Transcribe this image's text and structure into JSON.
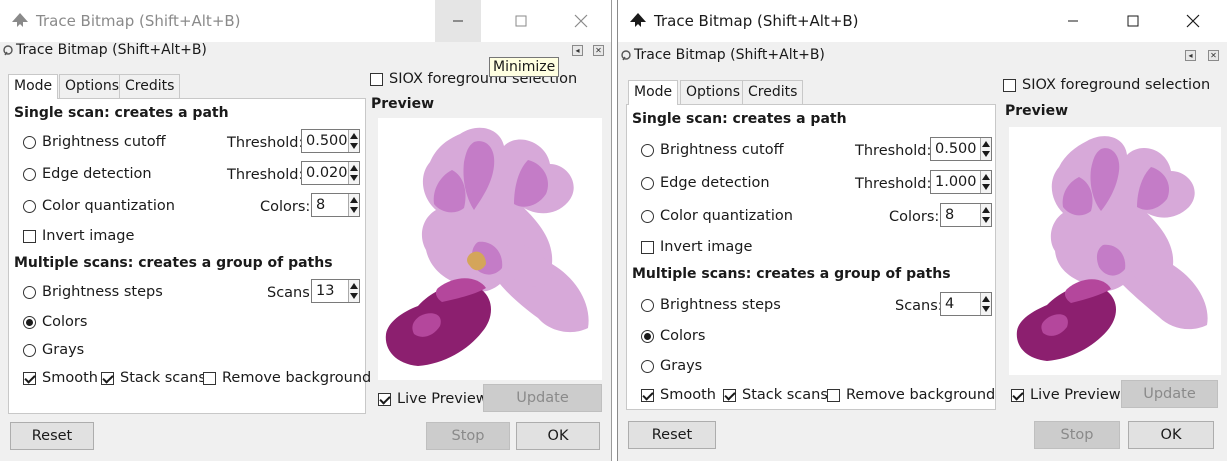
{
  "windows": [
    {
      "title": "Trace Bitmap (Shift+Alt+B)",
      "dock_title": "Trace Bitmap (Shift+Alt+B)",
      "tabs": [
        "Mode",
        "Options",
        "Credits"
      ],
      "siox_label": "SIOX foreground selection",
      "preview_label": "Preview",
      "single_heading": "Single scan: creates a path",
      "brightness_cutoff": "Brightness cutoff",
      "edge_detection": "Edge detection",
      "color_quantization": "Color quantization",
      "invert_image": "Invert image",
      "multiple_heading": "Multiple scans: creates a group of paths",
      "brightness_steps": "Brightness steps",
      "colors": "Colors",
      "grays": "Grays",
      "smooth": "Smooth",
      "stack_scans": "Stack scans",
      "remove_background": "Remove background",
      "threshold_label": "Threshold:",
      "threshold_brightness": "0.500",
      "threshold_edge": "0.020",
      "colors_label": "Colors:",
      "colors_value": "8",
      "scans_label": "Scans:",
      "scans_value": "13",
      "live_preview": "Live Preview",
      "update": "Update",
      "reset": "Reset",
      "stop": "Stop",
      "ok": "OK",
      "tooltip": "Minimize"
    },
    {
      "title": "Trace Bitmap (Shift+Alt+B)",
      "dock_title": "Trace Bitmap (Shift+Alt+B)",
      "tabs": [
        "Mode",
        "Options",
        "Credits"
      ],
      "siox_label": "SIOX foreground selection",
      "preview_label": "Preview",
      "single_heading": "Single scan: creates a path",
      "brightness_cutoff": "Brightness cutoff",
      "edge_detection": "Edge detection",
      "color_quantization": "Color quantization",
      "invert_image": "Invert image",
      "multiple_heading": "Multiple scans: creates a group of paths",
      "brightness_steps": "Brightness steps",
      "colors": "Colors",
      "grays": "Grays",
      "smooth": "Smooth",
      "stack_scans": "Stack scans",
      "remove_background": "Remove background",
      "threshold_label": "Threshold:",
      "threshold_brightness": "0.500",
      "threshold_edge": "1.000",
      "colors_label": "Colors:",
      "colors_value": "8",
      "scans_label": "Scans:",
      "scans_value": "4",
      "live_preview": "Live Preview",
      "update": "Update",
      "reset": "Reset",
      "stop": "Stop",
      "ok": "OK"
    }
  ],
  "icons": {
    "app": "inkscape-logo-icon",
    "dock": "dock-handle-icon",
    "minimize": "minimize-icon",
    "maximize": "maximize-icon",
    "close": "close-icon"
  },
  "colors": {
    "flower_light": "#d7a9d9",
    "flower_mid": "#c47cc7",
    "flower_dark": "#8c1f6f",
    "flower_center": "#d4a55a"
  }
}
